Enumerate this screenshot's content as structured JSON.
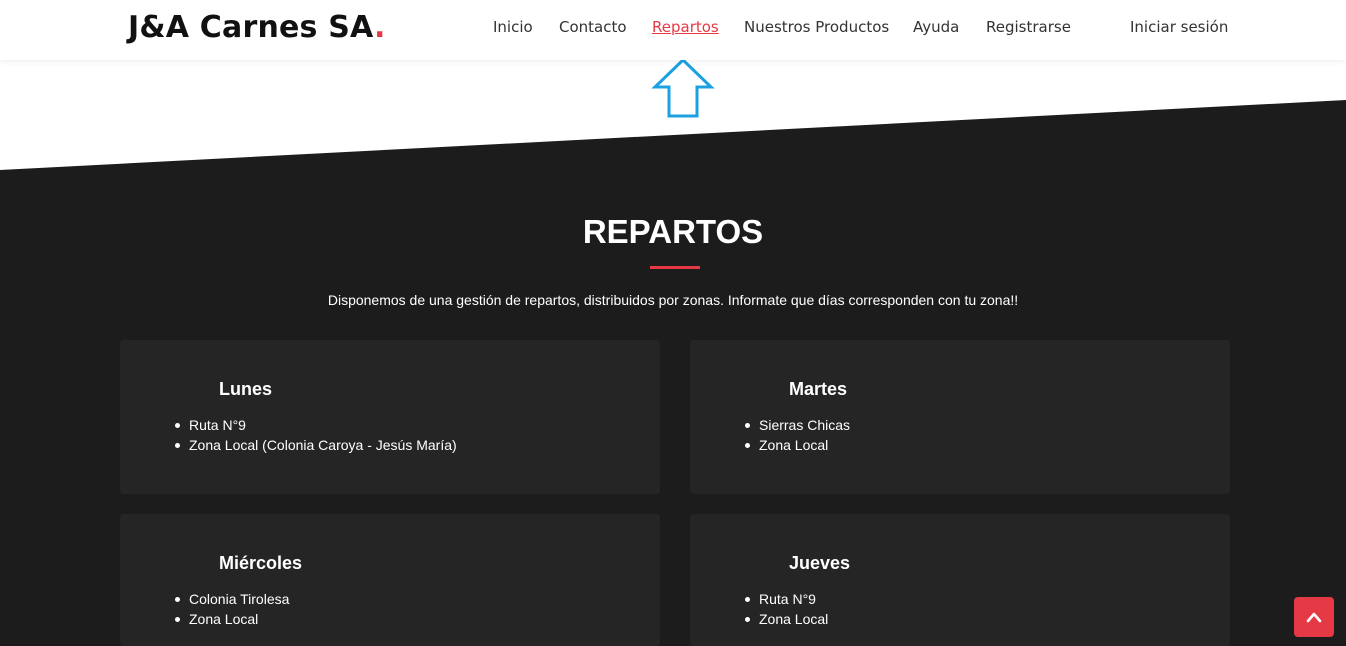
{
  "header": {
    "logo_text": "J&A Carnes SA",
    "logo_dot": ".",
    "nav": [
      {
        "label": "Inicio"
      },
      {
        "label": "Contacto"
      },
      {
        "label": "Repartos"
      },
      {
        "label": "Nuestros Productos"
      },
      {
        "label": "Ayuda"
      },
      {
        "label": "Registrarse"
      }
    ],
    "login_label": "Iniciar sesión"
  },
  "section": {
    "title": "REPARTOS",
    "intro": "Disponemos de una gestión de repartos, distribuidos por zonas. Informate que días corresponden con tu zona!!"
  },
  "days": [
    {
      "day": "Lunes",
      "zones": [
        "Ruta N°9",
        "Zona Local (Colonia Caroya - Jesús María)"
      ]
    },
    {
      "day": "Martes",
      "zones": [
        "Sierras Chicas",
        "Zona Local"
      ]
    },
    {
      "day": "Miércoles",
      "zones": [
        "Colonia Tirolesa",
        "Zona Local"
      ]
    },
    {
      "day": "Jueves",
      "zones": [
        "Ruta N°9",
        "Zona Local"
      ]
    }
  ],
  "colors": {
    "accent": "#e63946",
    "dark_bg": "#1c1c1c",
    "card_bg": "#252525",
    "arrow": "#1ba1e2"
  },
  "icons": {
    "annotation_arrow": "up-arrow-icon",
    "scroll_top": "chevron-up-icon"
  }
}
